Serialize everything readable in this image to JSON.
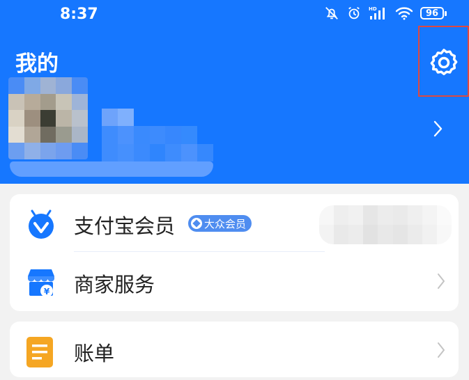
{
  "status_bar": {
    "time": "8:37",
    "battery": "96",
    "icons": [
      "mute-bell-icon",
      "alarm-clock-icon",
      "hd-signal-icon",
      "wifi-icon",
      "battery-icon"
    ]
  },
  "header": {
    "title": "我的",
    "background_color": "#1677ff",
    "settings_icon": "gear-icon"
  },
  "menu_card": {
    "items": [
      {
        "label": "支付宝会员",
        "badge": "大众会员",
        "icon": "member-icon"
      },
      {
        "label": "商家服务",
        "icon": "shop-icon"
      }
    ]
  },
  "bill_card": {
    "items": [
      {
        "label": "账单",
        "icon": "bill-icon"
      }
    ]
  },
  "colors": {
    "accent": "#1677ff",
    "highlight_box": "#e0483f",
    "bill_icon": "#f5a623"
  }
}
